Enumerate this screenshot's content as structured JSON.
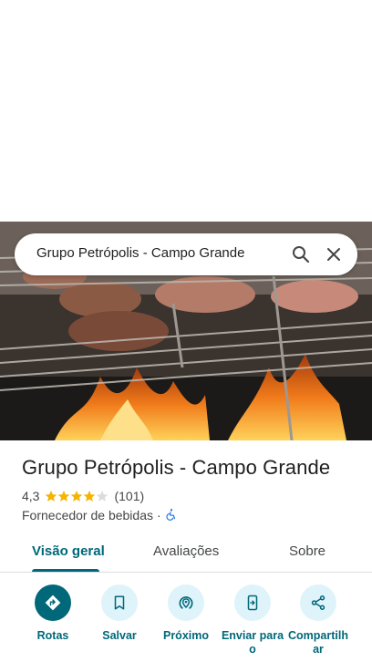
{
  "search": {
    "query": "Grupo Petrópolis - Campo Grande"
  },
  "place": {
    "name": "Grupo Petrópolis - Campo Grande",
    "rating": "4,3",
    "stars": 4.3,
    "review_count": "(101)",
    "category": "Fornecedor de bebidas",
    "separator": "·"
  },
  "tabs": [
    {
      "label": "Visão geral",
      "active": true
    },
    {
      "label": "Avaliações",
      "active": false
    },
    {
      "label": "Sobre",
      "active": false
    }
  ],
  "actions": [
    {
      "label": "Rotas",
      "icon": "directions-icon"
    },
    {
      "label": "Salvar",
      "icon": "bookmark-icon"
    },
    {
      "label": "Próximo",
      "icon": "nearby-icon"
    },
    {
      "label": "Enviar para o",
      "icon": "send-to-phone-icon"
    },
    {
      "label": "Compartilhar",
      "icon": "share-icon"
    }
  ],
  "colors": {
    "accent": "#006878",
    "action_bg": "#dff3fa",
    "star": "#f4b400"
  }
}
